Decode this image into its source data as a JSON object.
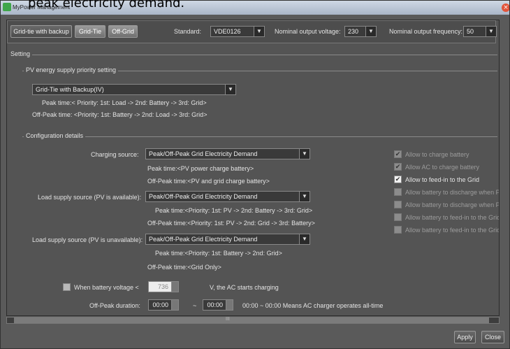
{
  "caption": "peak electricity demand.",
  "window": {
    "title": "MyPower Management"
  },
  "topbar": {
    "tabs": [
      "Grid-tie with backup",
      "Grid-Tie",
      "Off-Grid"
    ],
    "standard_label": "Standard:",
    "standard_value": "VDE0126",
    "voltage_label": "Nominal output voltage:",
    "voltage_value": "230",
    "frequency_label": "Nominal output frequency:",
    "frequency_value": "50"
  },
  "setting": {
    "legend": "Setting"
  },
  "pv_priority": {
    "legend": "PV energy supply priority setting",
    "selected": "Grid-Tie with Backup(IV)",
    "peak": "Peak time:< Priority: 1st: Load -> 2nd: Battery -> 3rd: Grid>",
    "offpeak": "Off-Peak time: <Priority: 1st: Battery -> 2nd: Load -> 3rd: Grid>"
  },
  "config": {
    "legend": "Configuration details",
    "charging_source_label": "Charging source:",
    "charging_source_value": "Peak/Off-Peak Grid Electricity Demand",
    "charging_peak": "Peak time:<PV power charge battery>",
    "charging_offpeak": "Off-Peak time:<PV and grid charge battery>",
    "load_pv_label": "Load supply source (PV is available):",
    "load_pv_value": "Peak/Off-Peak Grid Electricity Demand",
    "load_pv_peak": "Peak time:<Priority: 1st: PV -> 2nd: Battery -> 3rd: Grid>",
    "load_pv_offpeak": "Off-Peak time:<Priority: 1st: PV -> 2nd: Grid -> 3rd: Battery>",
    "load_nopv_label": "Load supply source (PV is unavailable):",
    "load_nopv_value": "Peak/Off-Peak Grid Electricity Demand",
    "load_nopv_peak": "Peak time:<Priority: 1st: Battery -> 2nd: Grid>",
    "load_nopv_offpeak": "Off-Peak time:<Grid Only>",
    "battery_voltage_label": "When battery voltage <",
    "battery_voltage_value": "736",
    "battery_voltage_suffix": "V,  the AC starts charging",
    "offpeak_duration_label": "Off-Peak duration:",
    "start_time": "00:00",
    "tilde": "~",
    "end_time": "00:00",
    "duration_note": "00:00 ~ 00:00 Means AC charger operates all-time"
  },
  "checks": [
    {
      "label": "Allow to charge battery",
      "checked": true,
      "enabled": false
    },
    {
      "label": "Allow AC to charge battery",
      "checked": true,
      "enabled": false
    },
    {
      "label": "Allow to feed-in to the Grid",
      "checked": true,
      "enabled": true
    },
    {
      "label": "Allow battery to discharge when PV",
      "checked": false,
      "enabled": false
    },
    {
      "label": "Allow battery to discharge when PV",
      "checked": false,
      "enabled": false
    },
    {
      "label": "Allow battery to feed-in to the Grid",
      "checked": false,
      "enabled": false
    },
    {
      "label": "Allow battery to feed-in to the Grid",
      "checked": false,
      "enabled": false
    }
  ],
  "hscroll_label": "III",
  "buttons": {
    "apply": "Apply",
    "close": "Close"
  }
}
